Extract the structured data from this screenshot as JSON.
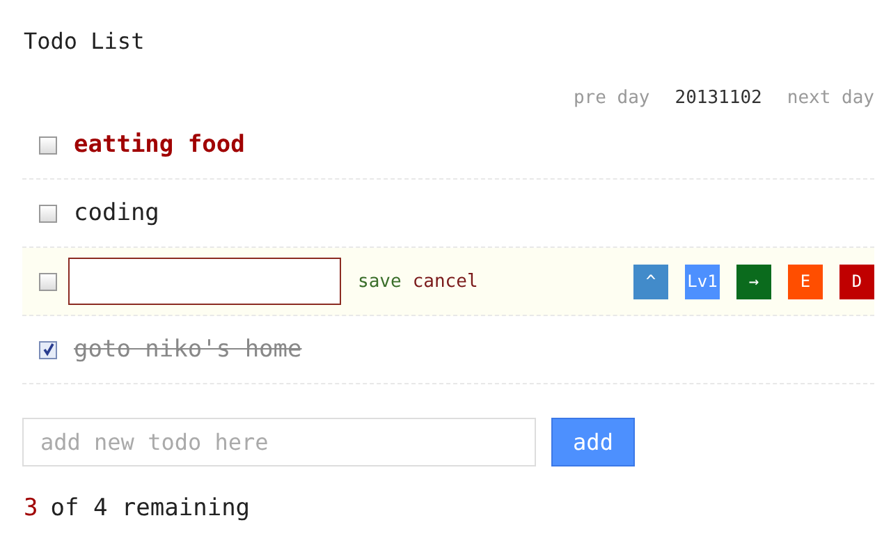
{
  "title": "Todo List",
  "day_nav": {
    "prev": "pre day",
    "date": "20131102",
    "next": "next day"
  },
  "todos": [
    {
      "kind": "text",
      "text": "eatting food",
      "checked": false,
      "important": true
    },
    {
      "kind": "text",
      "text": "coding",
      "checked": false,
      "important": false
    },
    {
      "kind": "editing",
      "checked": false,
      "links": [
        "save",
        "cancel"
      ],
      "actions": [
        {
          "label": "^",
          "color": "#428bca"
        },
        {
          "label": "Lv1",
          "color": "#4d90fe"
        },
        {
          "label": "→",
          "color": "#0b6b1d"
        },
        {
          "label": "E",
          "color": "#ff4e00"
        },
        {
          "label": "D",
          "color": "#c00000"
        }
      ]
    },
    {
      "kind": "text",
      "text": "goto niko's home",
      "checked": true,
      "important": false
    }
  ],
  "new_todo": {
    "placeholder": "add new todo here",
    "button": "add"
  },
  "footer": {
    "count": "3",
    "rest": "of 4 remaining"
  }
}
